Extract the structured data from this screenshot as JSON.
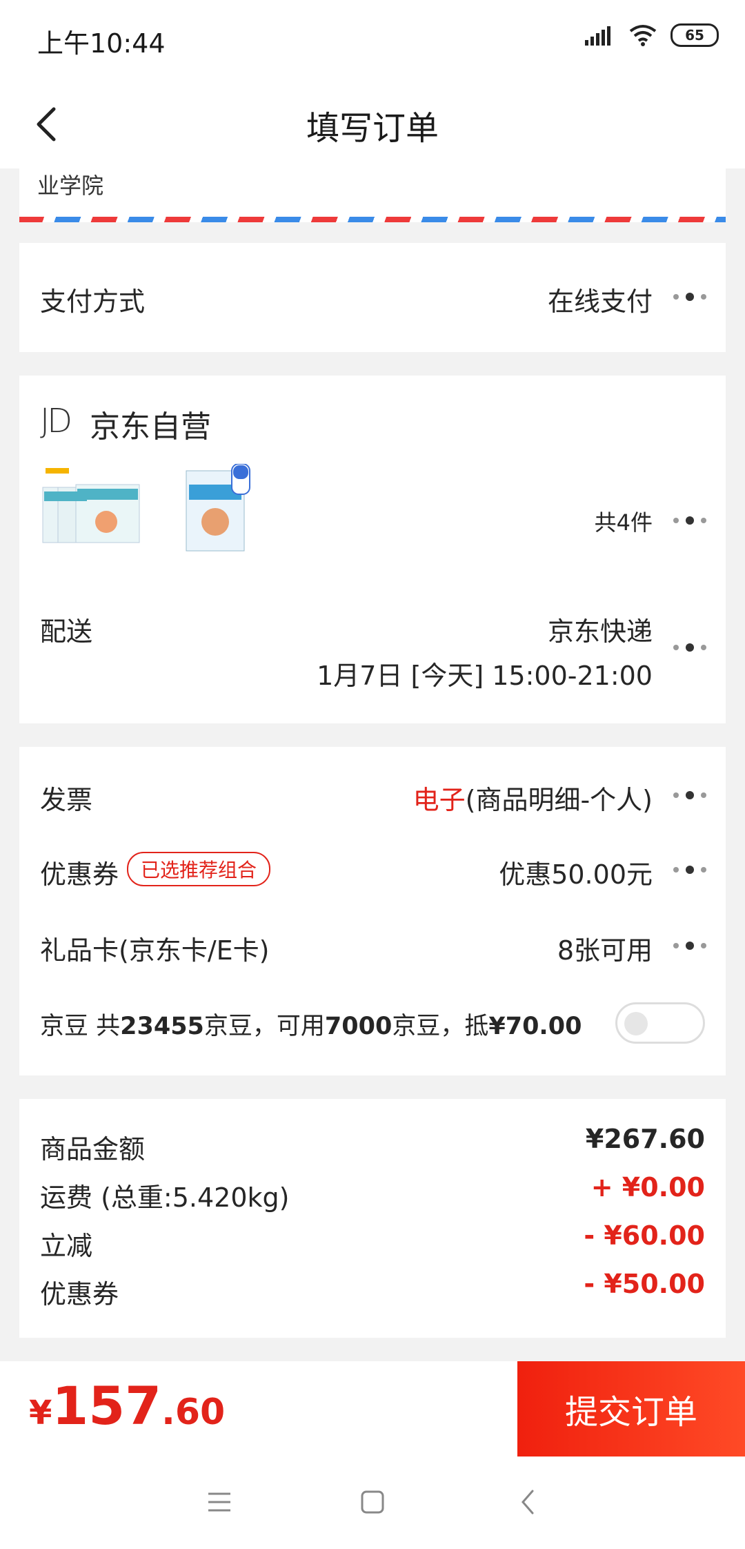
{
  "status_bar": {
    "time": "上午10:44",
    "battery": "65"
  },
  "nav": {
    "title": "填写订单"
  },
  "address": {
    "tail": "业学院"
  },
  "payment": {
    "label": "支付方式",
    "value": "在线支付"
  },
  "shop": {
    "logo_text": "JD",
    "name": "京东自营",
    "item_count": "共4件",
    "delivery_label": "配送",
    "delivery_company": "京东快递",
    "delivery_time": "1月7日 [今天] 15:00-21:00"
  },
  "invoice": {
    "label": "发票",
    "type": "电子",
    "detail": "(商品明细-个人)"
  },
  "coupon": {
    "label": "优惠券",
    "tag": "已选推荐组合",
    "value": "优惠50.00元"
  },
  "giftcard": {
    "label": "礼品卡(京东卡/E卡)",
    "value": "8张可用"
  },
  "jingdou": {
    "text_pre": "京豆 共",
    "total": "23455",
    "text_mid": "京豆，可用",
    "usable": "7000",
    "text_post": "京豆，抵",
    "amount": "¥70.00",
    "enabled": false
  },
  "summary": [
    {
      "label": "商品金额",
      "value": "¥267.60",
      "color": "#262626"
    },
    {
      "label": "运费 (总重:5.420kg)",
      "value": "+ ¥0.00",
      "color": "#e2231a"
    },
    {
      "label": "立减",
      "value": "- ¥60.00",
      "color": "#e2231a"
    },
    {
      "label": "优惠券",
      "value": "- ¥50.00",
      "color": "#e2231a"
    }
  ],
  "footer": {
    "currency": "¥",
    "total_int": "157",
    "total_dec": ".60",
    "submit_label": "提交订单"
  },
  "colors": {
    "accent": "#e2231a",
    "background": "#f2f2f2"
  }
}
